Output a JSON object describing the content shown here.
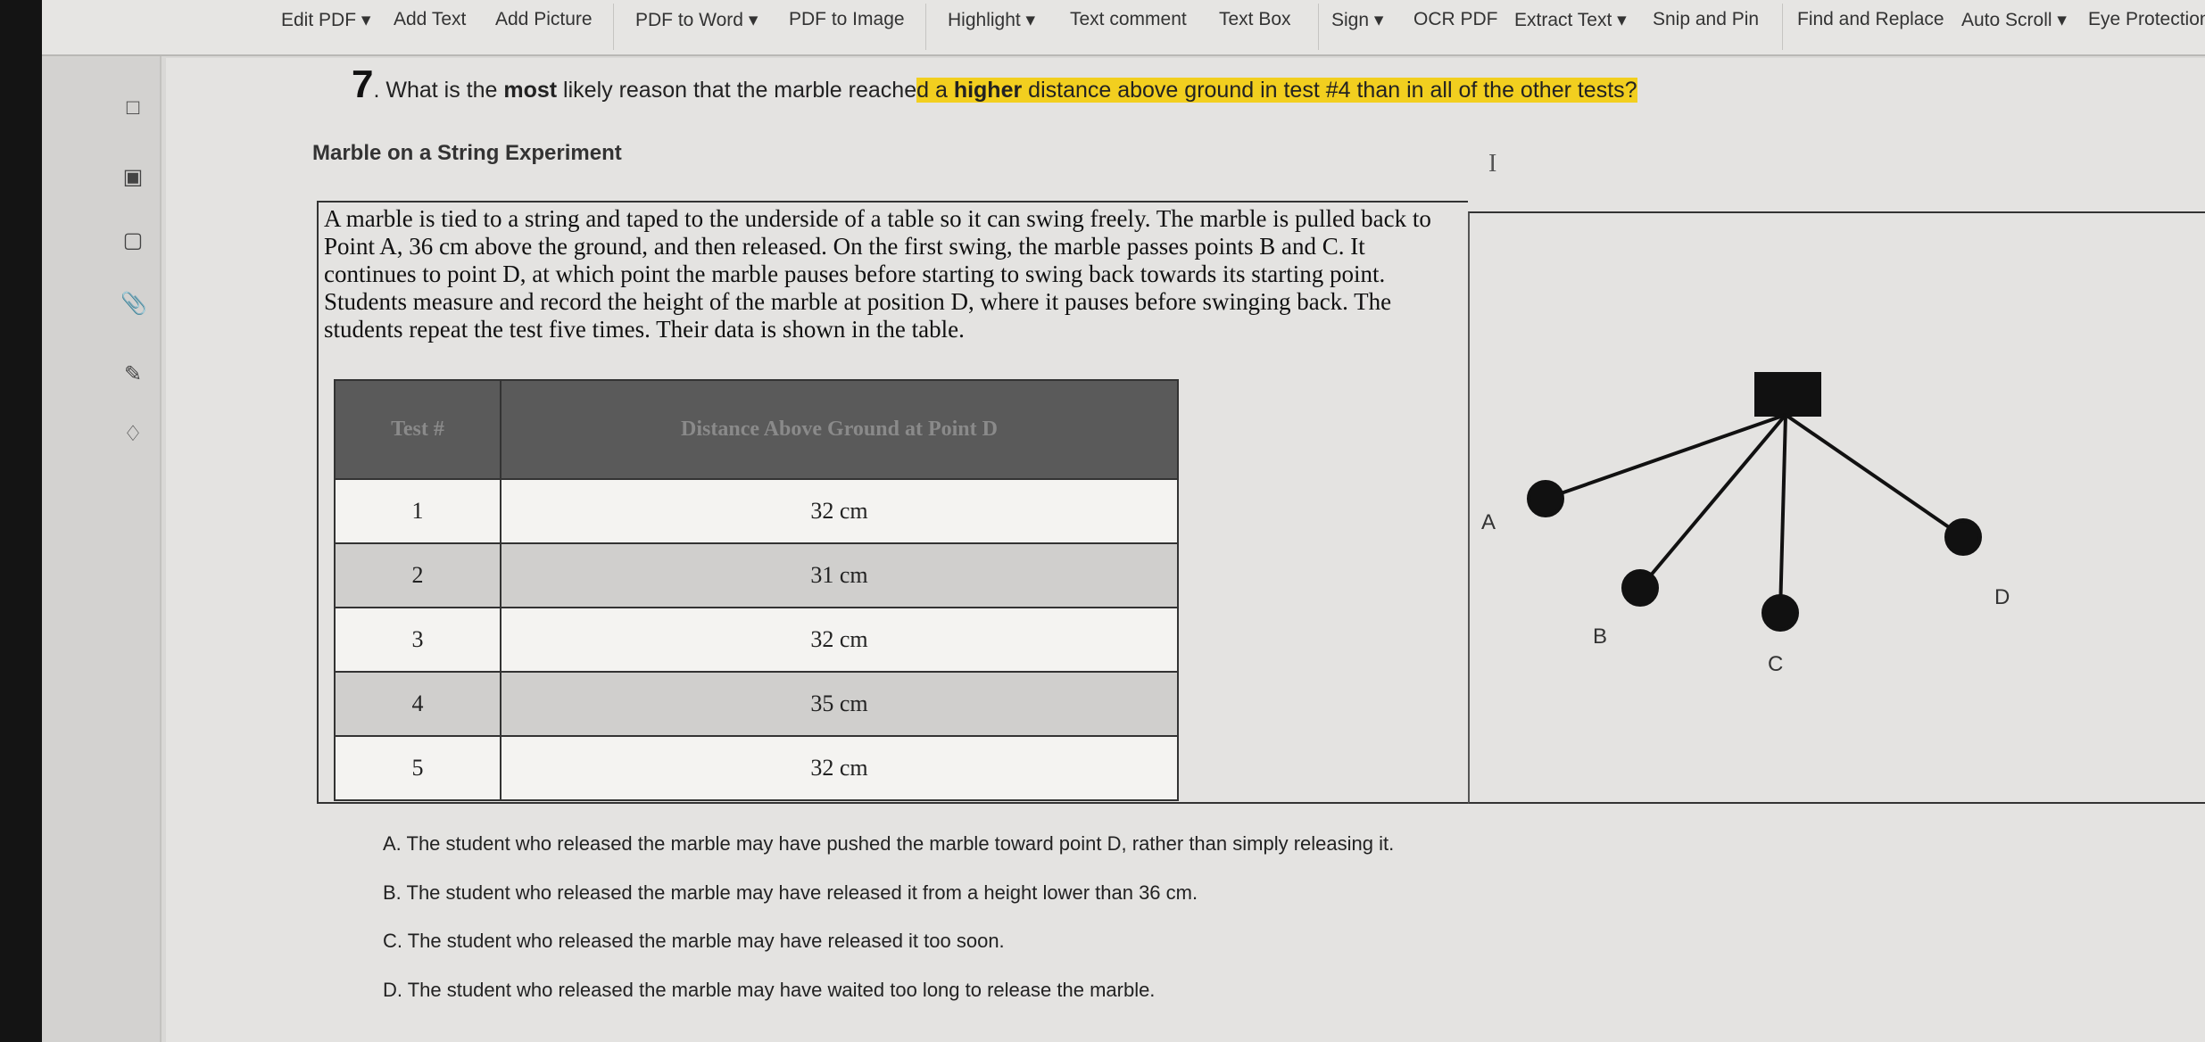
{
  "toolbar": {
    "items": [
      {
        "label": "Edit PDF",
        "dropdown": true
      },
      {
        "label": "Add Text"
      },
      {
        "label": "Add Picture"
      },
      {
        "label": "PDF to Word",
        "dropdown": true
      },
      {
        "label": "PDF to Image"
      },
      {
        "label": "Highlight",
        "dropdown": true
      },
      {
        "label": "Text comment"
      },
      {
        "label": "Text Box"
      },
      {
        "label": "Sign",
        "dropdown": true
      },
      {
        "label": "OCR PDF"
      },
      {
        "label": "Extract Text",
        "dropdown": true
      },
      {
        "label": "Snip and Pin"
      },
      {
        "label": "Find and Replace"
      },
      {
        "label": "Auto Scroll",
        "dropdown": true
      },
      {
        "label": "Eye Protection"
      }
    ]
  },
  "sidebar": {
    "icons": [
      "bookmark-icon",
      "thumbnail-icon",
      "comment-icon",
      "attachment-icon",
      "signature-icon",
      "layers-icon"
    ]
  },
  "question": {
    "number": "7",
    "pre": ". What is the ",
    "bold1": "most",
    "mid": " likely reason that the marble reache",
    "hl_start": "d",
    "hl_mid": " a ",
    "bold2": "higher",
    "hl_end": " distance above ground in test #4 than in all of the other tests?"
  },
  "heading": "Marble on a String Experiment",
  "passage": "A marble is tied to a string and taped to the underside of a table so it can swing freely. The marble is pulled back to Point A, 36 cm above the ground, and then released. On the first swing, the marble passes points B and C. It continues to point D, at which point the marble pauses before starting to swing back towards its starting point. Students measure and record the height of the marble at position D, where it pauses before swinging back. The students repeat the test five times. Their data is shown in the table.",
  "table": {
    "headers": [
      "Test #",
      "Distance Above Ground at Point D"
    ],
    "rows": [
      [
        "1",
        "32 cm"
      ],
      [
        "2",
        "31 cm"
      ],
      [
        "3",
        "32 cm"
      ],
      [
        "4",
        "35 cm"
      ],
      [
        "5",
        "32 cm"
      ]
    ]
  },
  "diagram": {
    "labels": {
      "a": "A",
      "b": "B",
      "c": "C",
      "d": "D"
    }
  },
  "answers": [
    "A.  The student who released the marble may have pushed the marble toward point D, rather than simply releasing it.",
    "B.  The student who released the marble may have released it from a height lower than 36 cm.",
    "C.  The student who released the marble may have released it too soon.",
    "D.  The student who released the marble may have waited too long to release the marble."
  ],
  "colors": {
    "highlight": "#f2cf1f",
    "table_header": "#5a5a5a"
  }
}
